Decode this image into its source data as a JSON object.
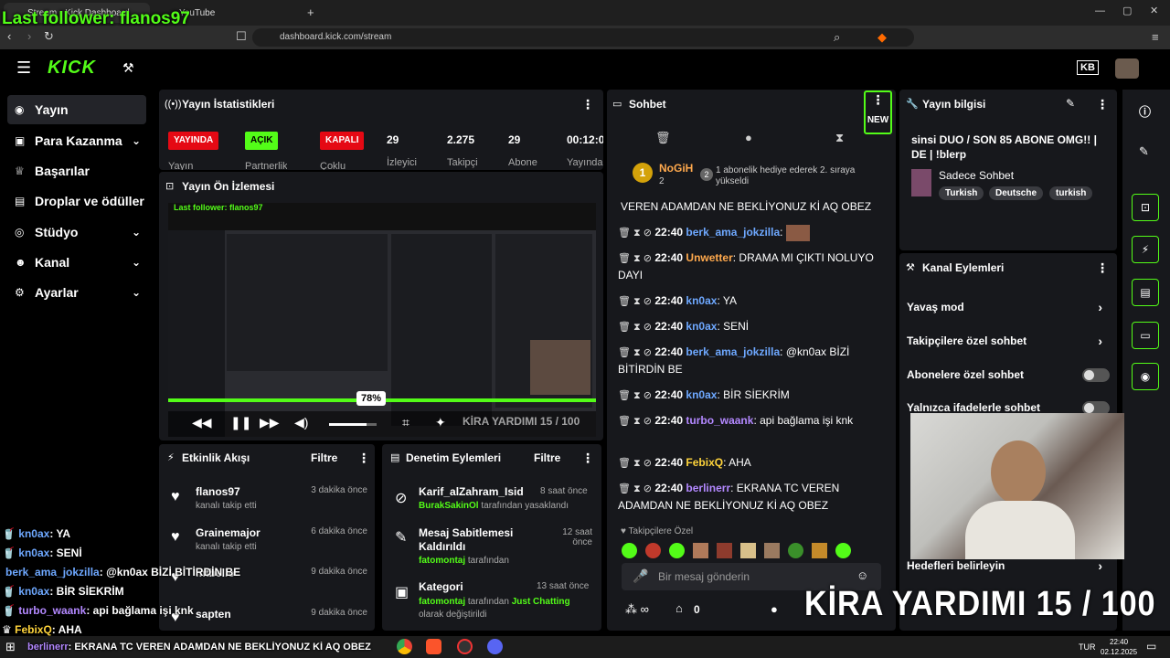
{
  "browser": {
    "tabs": [
      {
        "label": "Stream - Kick Dashboard"
      },
      {
        "label": "YouTube"
      }
    ],
    "url": "dashboard.kick.com/stream"
  },
  "overlay": {
    "last_follower": "Last follower: flanos97",
    "goal_text": "KİRA YARDIMI  15 / 100",
    "bottom_chat": [
      {
        "user": "kn0ax",
        "msg": ": YA"
      },
      {
        "user": "kn0ax",
        "msg": ": SENİ"
      },
      {
        "user": "berk_ama_jokzilla",
        "msg": ": @kn0ax BİZİ BİTİRDİN BE"
      },
      {
        "user": "kn0ax",
        "msg": ": BİR SİEKRİM"
      },
      {
        "user": "turbo_waank",
        "msg": ": api bağlama işi knk"
      },
      {
        "user": "FebixQ",
        "msg": ": AHA"
      },
      {
        "user": "berlinerr",
        "msg": ": EKRANA TC VEREN ADAMDAN NE BEKLİYONUZ Kİ AQ OBEZ"
      }
    ]
  },
  "sidebar": {
    "items": [
      {
        "label": "Yayın",
        "icon": "broadcast-icon"
      },
      {
        "label": "Para Kazanma",
        "icon": "money-icon"
      },
      {
        "label": "Başarılar",
        "icon": "trophy-icon"
      },
      {
        "label": "Droplar ve ödüller",
        "icon": "gift-icon"
      },
      {
        "label": "Stüdyo",
        "icon": "studio-icon"
      },
      {
        "label": "Kanal",
        "icon": "users-icon"
      },
      {
        "label": "Ayarlar",
        "icon": "gear-icon"
      }
    ]
  },
  "stats": {
    "title": "Yayın İstatistikleri",
    "badges": [
      {
        "label": "YAYINDA",
        "caption": "Yayın"
      },
      {
        "label": "AÇIK",
        "caption": "Partnerlik"
      },
      {
        "label": "KAPALI",
        "caption": "Çoklu"
      }
    ],
    "numbers": [
      {
        "value": "29",
        "label": "İzleyici"
      },
      {
        "value": "2.275",
        "label": "Takipçi"
      },
      {
        "value": "29",
        "label": "Abone"
      },
      {
        "value": "00:12:0",
        "label": "Yayında"
      }
    ]
  },
  "preview": {
    "title": "Yayın Ön İzlemesi",
    "volume_label": "78%",
    "volume": 0.78
  },
  "events": {
    "title": "Etkinlik Akışı",
    "filter": "Filtre",
    "items": [
      {
        "name": "flanos97",
        "sub": "kanalı takip etti",
        "time": "3 dakika önce"
      },
      {
        "name": "Grainemajor",
        "sub": "kanalı takip etti",
        "time": "6 dakika önce"
      },
      {
        "name": "mtbello",
        "sub": "",
        "time": "9 dakika önce"
      },
      {
        "name": "sapten",
        "sub": "",
        "time": "9 dakika önce"
      }
    ]
  },
  "moderation": {
    "title": "Denetim Eylemleri",
    "filter": "Filtre",
    "items": [
      {
        "title": "Karif_alZahram_Isid",
        "actor": "BurakSakinOl",
        "desc": "tarafından yasaklandı",
        "time": "8 saat önce"
      },
      {
        "title": "Mesaj Sabitlemesi Kaldırıldı",
        "actor": "fatomontaj",
        "desc": "tarafından",
        "time": "12 saat önce"
      },
      {
        "title": "Kategori",
        "actor": "fatomontaj",
        "desc": "tarafından",
        "extra": "Just Chatting",
        "desc2": "olarak değiştirildi",
        "time": "13 saat önce"
      }
    ]
  },
  "chat": {
    "title": "Sohbet",
    "new_badge": "NEW",
    "gifter": {
      "name": "NoGiH",
      "count": "2",
      "rank": "1",
      "note": "1 abonelik hediye ederek 2. sıraya yükseldi",
      "note_count": "2"
    },
    "lines": [
      {
        "time": "",
        "user": "",
        "text": "VEREN ADAMDAN NE BEKLİYONUZ Kİ AQ OBEZ"
      },
      {
        "time": "22:40",
        "user": "berk_ama_jokzilla",
        "text": ":"
      },
      {
        "time": "22:40",
        "user": "Unwetter",
        "text": ": DRAMA MI ÇIKTI NOLUYO DAYI"
      },
      {
        "time": "22:40",
        "user": "kn0ax",
        "text": ": YA"
      },
      {
        "time": "22:40",
        "user": "kn0ax",
        "text": ": SENİ"
      },
      {
        "time": "22:40",
        "user": "berk_ama_jokzilla",
        "text": ": @kn0ax BİZİ BİTİRDİN BE"
      },
      {
        "time": "22:40",
        "user": "kn0ax",
        "text": ": BİR SİEKRİM"
      },
      {
        "time": "22:40",
        "user": "turbo_waank",
        "text": ": api bağlama işi knk"
      },
      {
        "time": "22:40",
        "user": "FebixQ",
        "text": ": AHA"
      },
      {
        "time": "22:40",
        "user": "berlinerr",
        "text": ": EKRANA TC VEREN ADAMDAN NE BEKLİYONUZ Kİ AQ OBEZ"
      }
    ],
    "followers_only": "Takipçilere Özel",
    "placeholder": "Bir mesaj gönderin",
    "points": "0"
  },
  "stream_info": {
    "title": "Yayın bilgisi",
    "stream_title": "sinsi DUO / SON 85 ABONE OMG!! | DE | !blerp",
    "category": "Sadece Sohbet",
    "tags": [
      "Turkish",
      "Deutsche",
      "turkish"
    ]
  },
  "channel_actions": {
    "title": "Kanal Eylemleri",
    "items": [
      {
        "label": "Yavaş mod",
        "type": "arrow"
      },
      {
        "label": "Takipçilere özel sohbet",
        "type": "arrow"
      },
      {
        "label": "Abonelere özel sohbet",
        "type": "toggle",
        "on": false
      },
      {
        "label": "Yalnızca ifadelerle sohbet",
        "type": "toggle",
        "on": false
      },
      {
        "label": "Hedefleri belirleyin",
        "type": "arrow"
      }
    ]
  },
  "taskbar": {
    "lang": "TUR",
    "time": "22:40",
    "date": "02.12.2025"
  },
  "colors": {
    "accent": "#53fc18",
    "live": "#e50914"
  }
}
